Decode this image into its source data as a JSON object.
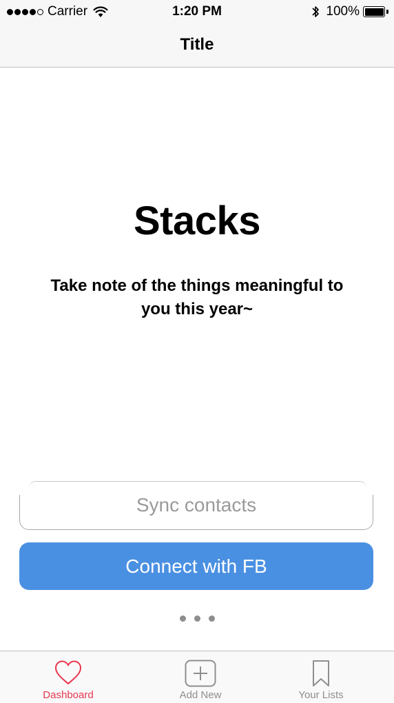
{
  "status_bar": {
    "carrier": "Carrier",
    "time": "1:20 PM",
    "battery": "100%",
    "signal_bars_filled": 4,
    "signal_bars_total": 5
  },
  "nav": {
    "title": "Title"
  },
  "main": {
    "app_name": "Stacks",
    "tagline": "Take note of the things meaningful to you this year~",
    "sync_label": "Sync contacts",
    "connect_label": "Connect with FB",
    "page_count": 3
  },
  "tabs": [
    {
      "label": "Dashboard",
      "icon": "heart-icon",
      "active": true
    },
    {
      "label": "Add New",
      "icon": "plus-square-icon",
      "active": false
    },
    {
      "label": "Your Lists",
      "icon": "bookmark-icon",
      "active": false
    }
  ],
  "colors": {
    "accent": "#4a90e2",
    "active_tab": "#e8364f",
    "inactive_tab": "#8e8e8e"
  }
}
